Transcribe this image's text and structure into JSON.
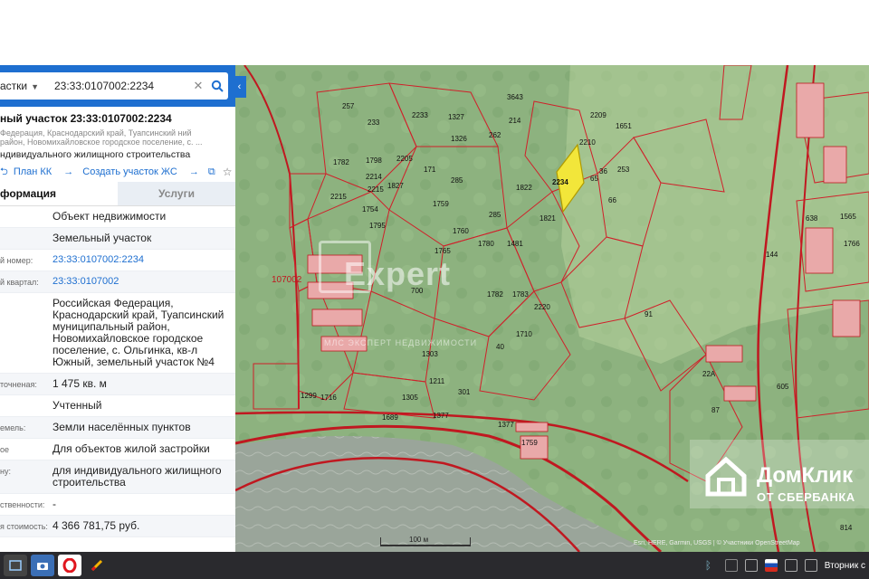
{
  "search": {
    "type_label": "астки",
    "value": "23:33:0107002:2234",
    "clear_icon": "close-icon",
    "search_icon": "search-icon"
  },
  "object": {
    "title": "ный участок 23:33:0107002:2234",
    "address": "Федерация, Краснодарский край, Туапсинский ний район, Новомихайловское городское поселение, с. ...",
    "use": "ндивидуального жилищного строительства"
  },
  "links": {
    "plan": "План КК",
    "create": "Создать участок ЖС"
  },
  "tabs": {
    "info": "формация",
    "services": "Услуги"
  },
  "rows": [
    {
      "label": "",
      "value": "Объект недвижимости"
    },
    {
      "label": "",
      "value": "Земельный участок"
    },
    {
      "label": "й номер:",
      "value": "23:33:0107002:2234",
      "link": true
    },
    {
      "label": "й квартал:",
      "value": "23:33:0107002",
      "link": true
    },
    {
      "label": "",
      "value": "Российская Федерация, Краснодарский край, Туапсинский муниципальный район, Новомихайловское городское поселение, с. Ольгинка, кв-л Южный, земельный участок №4"
    },
    {
      "label": "точненая:",
      "value": "1 475 кв. м"
    },
    {
      "label": "",
      "value": "Учтенный"
    },
    {
      "label": "емель:",
      "value": "Земли населённых пунктов"
    },
    {
      "label": "ое",
      "value": "Для объектов жилой застройки"
    },
    {
      "label": "ну:",
      "value": "для индивидуального жилищного строительства"
    },
    {
      "label": "ственности:",
      "value": "-"
    },
    {
      "label": "я стоимость:",
      "value": "4 366 781,75 руб."
    }
  ],
  "map": {
    "block_label": "107002",
    "parcel_labels": [
      "3643",
      "257",
      "233",
      "2233",
      "1327",
      "214",
      "2209",
      "1651",
      "2210",
      "2215",
      "1326",
      "262",
      "36",
      "253",
      "171",
      "2205",
      "1782",
      "1798",
      "1759",
      "285",
      "1822",
      "2234",
      "65",
      "66",
      "2215",
      "2214",
      "1827",
      "1754",
      "1760",
      "1765",
      "1780",
      "285",
      "1821",
      "1481",
      "1795",
      "700",
      "1782",
      "2220",
      "91",
      "1783",
      "1716",
      "1303",
      "1211",
      "40",
      "1710",
      "301",
      "1299",
      "1305",
      "1689",
      "1377",
      "1377",
      "1759",
      "22А",
      "605",
      "87",
      "814",
      "1565",
      "638",
      "1766",
      "144"
    ],
    "selected_parcel": "2234",
    "scale_label": "100 м",
    "attribution": "Esri, HERE, Garmin, USGS | © Участники OpenStreetMap"
  },
  "watermark": {
    "name": "Expert",
    "sub": "МЛС ЭКСПЕРТ НЕДВИЖИМОСТИ"
  },
  "domklik": {
    "name": "ДомКлик",
    "sub": "ОТ СБЕРБАНКА"
  },
  "taskbar": {
    "time": "Вторник с"
  },
  "colors": {
    "accent": "#1e6fd0",
    "parcel_line": "#d0202a",
    "selected_fill": "#f2e63a",
    "map_green": "#8fb581"
  }
}
